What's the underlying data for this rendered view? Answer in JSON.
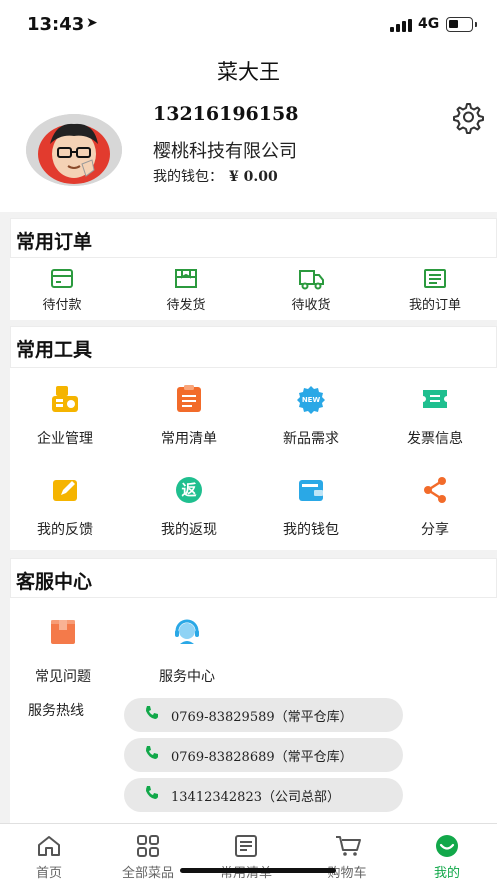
{
  "status_bar": {
    "time": "13:43",
    "network": "4G"
  },
  "nav": {
    "title": "菜大王"
  },
  "profile": {
    "phone": "13216196158",
    "company": "樱桃科技有限公司",
    "wallet_label": "我的钱包：",
    "wallet_amount": "¥ 0.00"
  },
  "orders": {
    "title": "常用订单",
    "items": [
      {
        "label": "待付款",
        "icon": "wallet-card-icon"
      },
      {
        "label": "待发货",
        "icon": "package-box-icon"
      },
      {
        "label": "待收货",
        "icon": "delivery-truck-icon"
      },
      {
        "label": "我的订单",
        "icon": "order-list-icon"
      }
    ]
  },
  "tools": {
    "title": "常用工具",
    "items": [
      {
        "label": "企业管理",
        "icon": "enterprise-icon",
        "color": "#f5b400"
      },
      {
        "label": "常用清单",
        "icon": "clipboard-icon",
        "color": "#f26b2a"
      },
      {
        "label": "新品需求",
        "icon": "new-badge-icon",
        "color": "#2aa8e6"
      },
      {
        "label": "发票信息",
        "icon": "ticket-icon",
        "color": "#1fbf8f"
      },
      {
        "label": "我的反馈",
        "icon": "edit-feedback-icon",
        "color": "#f5b400"
      },
      {
        "label": "我的返现",
        "icon": "cashback-icon",
        "color": "#1fbf8f"
      },
      {
        "label": "我的钱包",
        "icon": "wallet-icon",
        "color": "#2aa8e6"
      },
      {
        "label": "分享",
        "icon": "share-icon",
        "color": "#f26b2a"
      }
    ],
    "cashback_glyph": "返"
  },
  "service": {
    "title": "客服中心",
    "items": [
      {
        "label": "常见问题",
        "icon": "faq-book-icon"
      },
      {
        "label": "服务中心",
        "icon": "customer-service-icon"
      }
    ],
    "hotline_label": "服务热线",
    "hotlines": [
      "0769-83829589（常平仓库）",
      "0769-83828689（常平仓库）",
      "13412342823（公司总部）"
    ]
  },
  "tabbar": {
    "items": [
      {
        "label": "首页",
        "icon": "home-icon"
      },
      {
        "label": "全部菜品",
        "icon": "grid-icon"
      },
      {
        "label": "常用清单",
        "icon": "list-icon"
      },
      {
        "label": "购物车",
        "icon": "cart-icon"
      },
      {
        "label": "我的",
        "icon": "smile-icon"
      }
    ],
    "active_color": "#12a84a"
  }
}
